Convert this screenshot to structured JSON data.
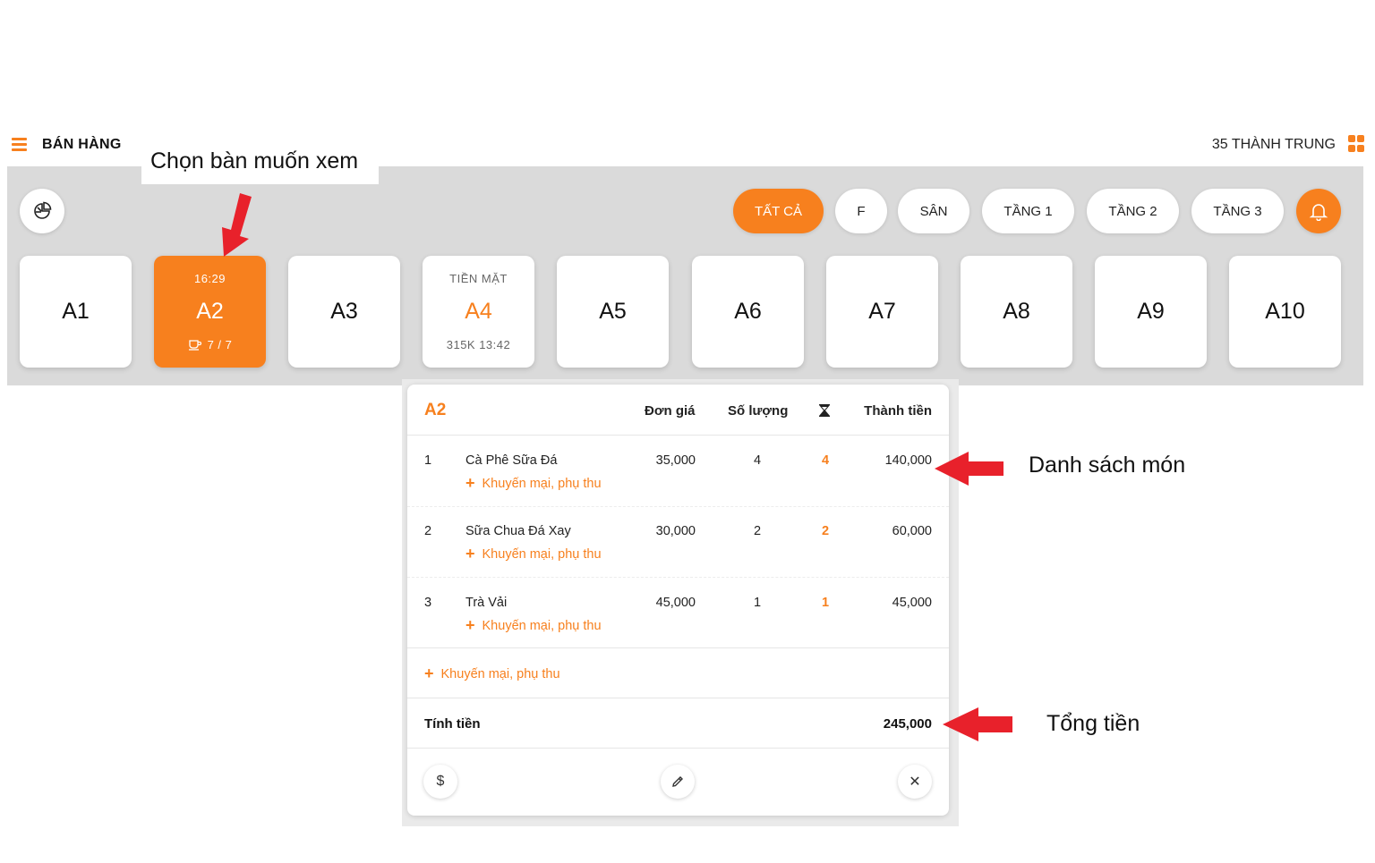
{
  "header": {
    "title": "BÁN HÀNG",
    "store": "35 THÀNH TRUNG",
    "menu_icon": "hamburger-icon",
    "grid_icon": "grid-icon"
  },
  "filters": [
    "TẤT CẢ",
    "F",
    "SÂN",
    "TẦNG 1",
    "TẦNG 2",
    "TẦNG 3"
  ],
  "tables": [
    {
      "name": "A1",
      "top": "",
      "bottom": ""
    },
    {
      "name": "A2",
      "top": "16:29",
      "bottom": "7 / 7"
    },
    {
      "name": "A3",
      "top": "",
      "bottom": ""
    },
    {
      "name": "A4",
      "top": "TIỀN MẶT",
      "bottom": "315K 13:42"
    },
    {
      "name": "A5",
      "top": "",
      "bottom": ""
    },
    {
      "name": "A6",
      "top": "",
      "bottom": ""
    },
    {
      "name": "A7",
      "top": "",
      "bottom": ""
    },
    {
      "name": "A8",
      "top": "",
      "bottom": ""
    },
    {
      "name": "A9",
      "top": "",
      "bottom": ""
    },
    {
      "name": "A10",
      "top": "",
      "bottom": ""
    }
  ],
  "annotations": {
    "select_table": "Chọn bàn muốn xem",
    "items_list": "Danh sách món",
    "total": "Tổng tiền"
  },
  "order": {
    "table": "A2",
    "columns": {
      "unit_price": "Đơn giá",
      "quantity": "Số lượng",
      "amount": "Thành tiền"
    },
    "items": [
      {
        "no": "1",
        "name": "Cà Phê Sữa Đá",
        "price": "35,000",
        "qty": "4",
        "pending": "4",
        "amount": "140,000",
        "promo": "Khuyến mại, phụ thu"
      },
      {
        "no": "2",
        "name": "Sữa Chua Đá Xay",
        "price": "30,000",
        "qty": "2",
        "pending": "2",
        "amount": "60,000",
        "promo": "Khuyến mại, phụ thu"
      },
      {
        "no": "3",
        "name": "Trà Vải",
        "price": "45,000",
        "qty": "1",
        "pending": "1",
        "amount": "45,000",
        "promo": "Khuyến mại, phụ thu"
      }
    ],
    "order_promo": "Khuyến mại, phụ thu",
    "total_label": "Tính tiền",
    "total_value": "245,000"
  },
  "colors": {
    "accent": "#f7801e",
    "panel": "#dadada",
    "arrow": "#e8212b"
  }
}
